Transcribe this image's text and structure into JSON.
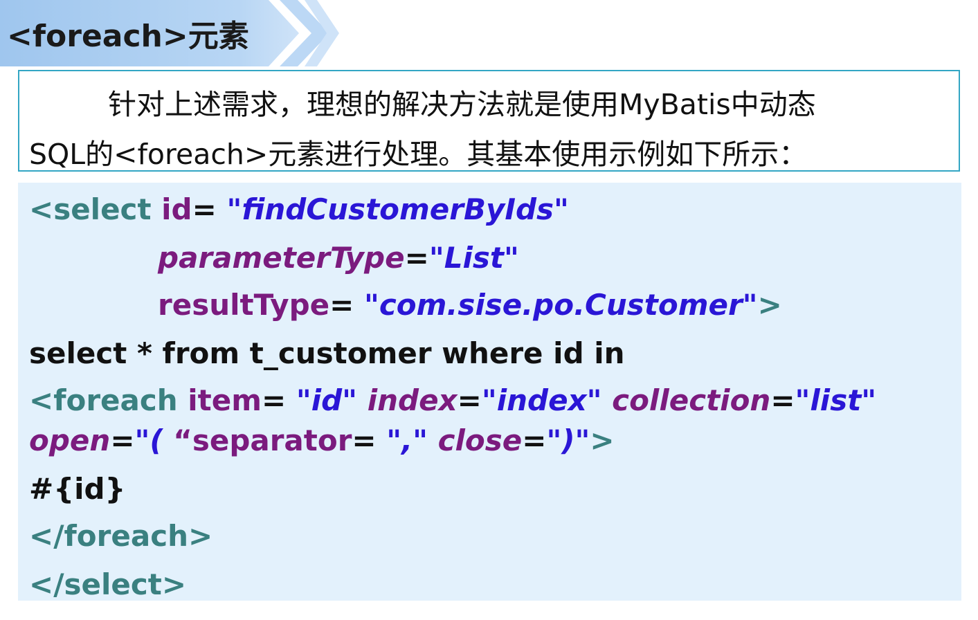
{
  "banner": {
    "title": "<foreach>元素",
    "colors": {
      "fill": "#a9cdf0",
      "chevron": "#bcd8f5"
    }
  },
  "description": {
    "line1": "针对上述需求，理想的解决方法就是使用MyBatis中动态",
    "line2": "SQL的<foreach>元素进行处理。其基本使用示例如下所示："
  },
  "code": {
    "line1": {
      "tag": "<select",
      "attr": "id",
      "eq": "=",
      "value": "\"findCustomerByIds\""
    },
    "line2": {
      "attr": "parameterType",
      "eq": "=",
      "value": "\"List\""
    },
    "line3": {
      "attr": "resultType",
      "eq": "=",
      "value": "\"com.sise.po.Customer\"",
      "close": ">"
    },
    "line4": {
      "text": "select * from t_customer where id in"
    },
    "line5": {
      "tag": "<foreach",
      "attr1": "item",
      "eq1": "=",
      "value1": "\"id\"",
      "attr2": "index",
      "eq2": "=",
      "value2": "\"index\"",
      "attr3": "collection",
      "eq3": "=",
      "value3": "\"list\""
    },
    "line6": {
      "attr1": "open",
      "eq1": "=",
      "value1": "\"(",
      "sep_prefix": "“",
      "attr2": "separator",
      "eq2": "=",
      "value2": "\",\"",
      "attr3": "close",
      "eq3": "=",
      "value3": "\")\"",
      "close": ">"
    },
    "line7": {
      "text": "#{id}"
    },
    "line8": {
      "text": "</foreach>"
    },
    "line9": {
      "text": "</select>"
    }
  }
}
